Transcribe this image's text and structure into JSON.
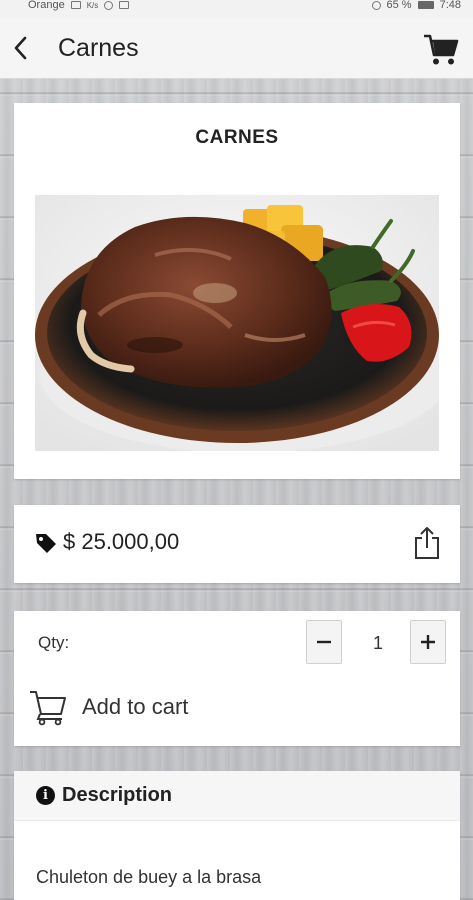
{
  "status_bar": {
    "carrier": "Orange",
    "network_speed": "K/s",
    "battery": "65 %",
    "time": "7:48"
  },
  "header": {
    "title": "Carnes",
    "back_icon": "back-arrow-icon",
    "cart_icon": "shopping-cart-icon"
  },
  "product": {
    "name": "CARNES",
    "image_subject": "grilled-steak-photo",
    "carousel_dots": 1
  },
  "price": {
    "value": "$ 25.000,00",
    "tag_icon": "price-tag-icon",
    "share_icon": "share-icon"
  },
  "quantity": {
    "label": "Qty:",
    "value": "1",
    "minus_symbol": "−",
    "plus_symbol": "+"
  },
  "cart_action": {
    "label": "Add to cart",
    "icon": "cart-outline-icon"
  },
  "description": {
    "title": "Description",
    "info_symbol": "i",
    "text": "Chuleton de buey a la brasa"
  }
}
